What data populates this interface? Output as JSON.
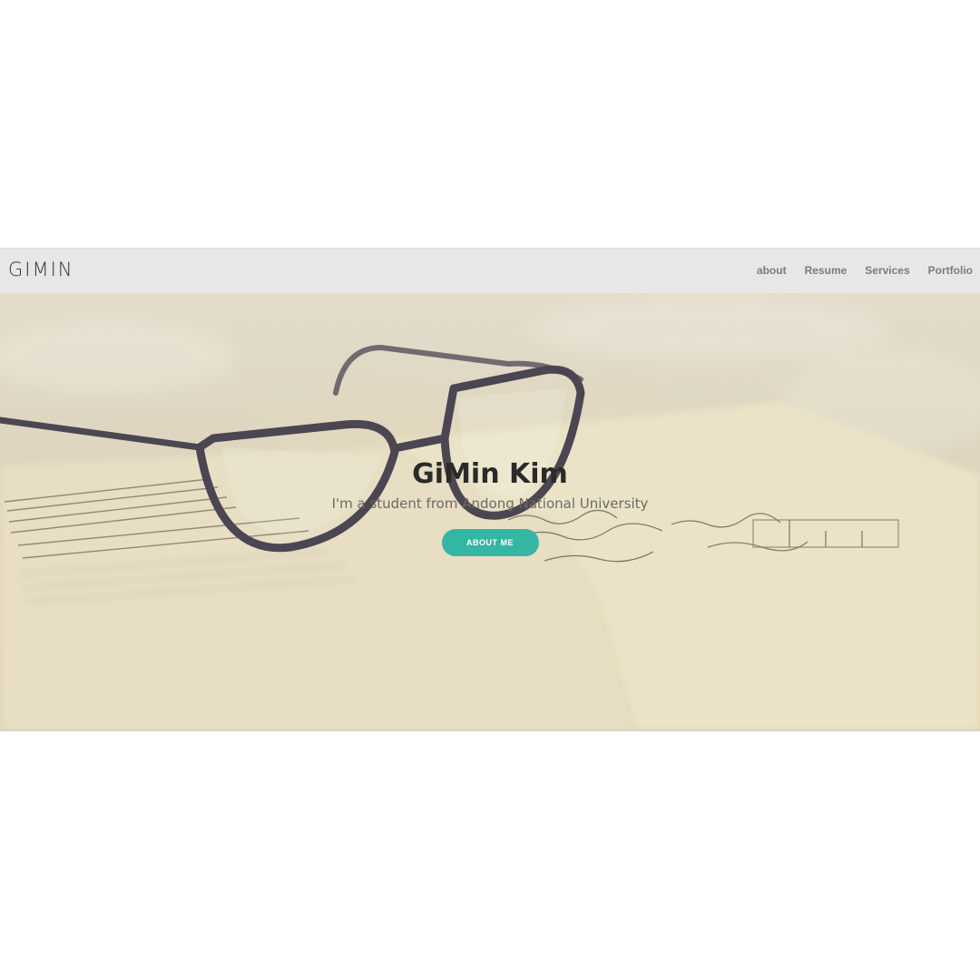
{
  "navbar": {
    "brand": "GIMIN",
    "links": [
      {
        "label": "about"
      },
      {
        "label": "Resume"
      },
      {
        "label": "Services"
      },
      {
        "label": "Portfolio"
      }
    ]
  },
  "hero": {
    "title": "GiMin Kim",
    "subtitle": "I'm a student from Andong National University",
    "button_label": "ABOUT ME",
    "background_image": "glasses-on-open-book",
    "colors": {
      "navbar_bg": "#e8e7e5",
      "accent": "#35b5a3",
      "title": "#2a2a2a",
      "subtitle": "#6d6a62"
    }
  }
}
